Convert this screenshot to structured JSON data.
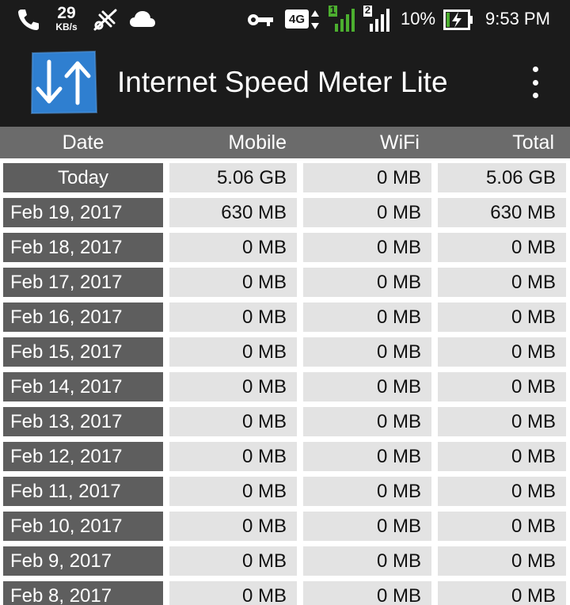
{
  "status_bar": {
    "net_speed_value": "29",
    "net_speed_unit": "KB/s",
    "network_badge": "4G",
    "sim1_label": "1",
    "sim2_label": "2",
    "battery_percent": "10%",
    "time": "9:53 PM",
    "accent_green": "#4caf2f"
  },
  "app_bar": {
    "title": "Internet Speed Meter Lite",
    "logo_color": "#2f7fd0"
  },
  "table": {
    "headers": {
      "date": "Date",
      "mobile": "Mobile",
      "wifi": "WiFi",
      "total": "Total"
    },
    "rows": [
      {
        "date": "Today",
        "mobile": "5.06 GB",
        "wifi": "0 MB",
        "total": "5.06 GB"
      },
      {
        "date": "Feb 19, 2017",
        "mobile": "630 MB",
        "wifi": "0 MB",
        "total": "630 MB"
      },
      {
        "date": "Feb 18, 2017",
        "mobile": "0 MB",
        "wifi": "0 MB",
        "total": "0 MB"
      },
      {
        "date": "Feb 17, 2017",
        "mobile": "0 MB",
        "wifi": "0 MB",
        "total": "0 MB"
      },
      {
        "date": "Feb 16, 2017",
        "mobile": "0 MB",
        "wifi": "0 MB",
        "total": "0 MB"
      },
      {
        "date": "Feb 15, 2017",
        "mobile": "0 MB",
        "wifi": "0 MB",
        "total": "0 MB"
      },
      {
        "date": "Feb 14, 2017",
        "mobile": "0 MB",
        "wifi": "0 MB",
        "total": "0 MB"
      },
      {
        "date": "Feb 13, 2017",
        "mobile": "0 MB",
        "wifi": "0 MB",
        "total": "0 MB"
      },
      {
        "date": "Feb 12, 2017",
        "mobile": "0 MB",
        "wifi": "0 MB",
        "total": "0 MB"
      },
      {
        "date": "Feb 11, 2017",
        "mobile": "0 MB",
        "wifi": "0 MB",
        "total": "0 MB"
      },
      {
        "date": "Feb 10, 2017",
        "mobile": "0 MB",
        "wifi": "0 MB",
        "total": "0 MB"
      },
      {
        "date": "Feb 9, 2017",
        "mobile": "0 MB",
        "wifi": "0 MB",
        "total": "0 MB"
      },
      {
        "date": "Feb 8, 2017",
        "mobile": "0 MB",
        "wifi": "0 MB",
        "total": "0 MB"
      }
    ]
  }
}
